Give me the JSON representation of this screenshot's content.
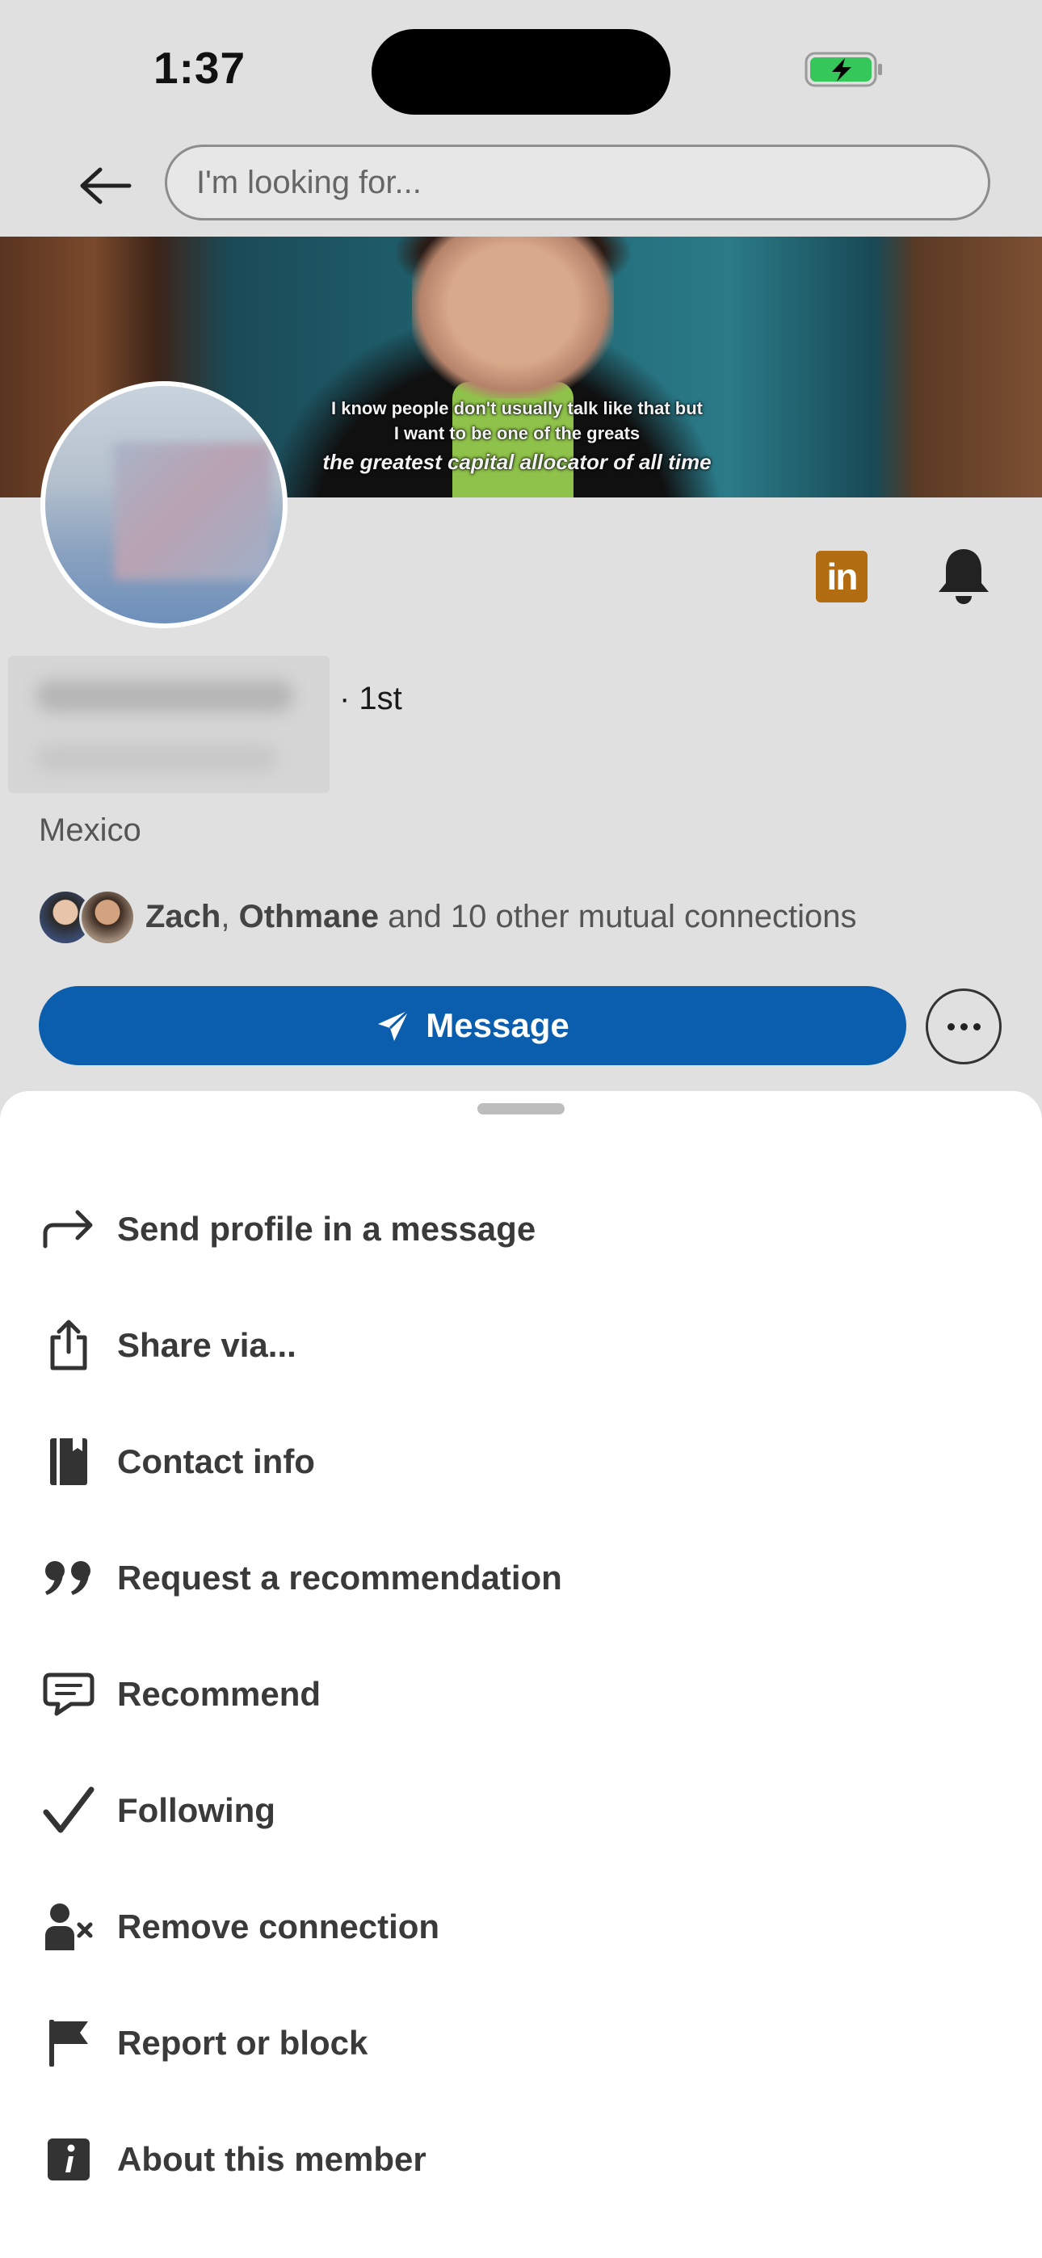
{
  "status_bar": {
    "time": "1:37"
  },
  "header": {
    "search_placeholder": "I'm looking for..."
  },
  "banner": {
    "caption_line1": "I know people don't usually talk like that but",
    "caption_line2": "I want to be one of the greats",
    "caption_line3": "the greatest capital allocator of all time"
  },
  "profile": {
    "linkedin_logo_text": "in",
    "degree": "· 1st",
    "location": "Mexico",
    "mutual": {
      "name1": "Zach",
      "sep": ", ",
      "name2": "Othmane",
      "rest": " and 10 other mutual connections"
    },
    "message_label": "Message"
  },
  "menu": {
    "items": [
      {
        "label": "Send profile in a message",
        "icon": "share-arrow-icon"
      },
      {
        "label": "Share via...",
        "icon": "share-icon"
      },
      {
        "label": "Contact info",
        "icon": "contact-book-icon"
      },
      {
        "label": "Request a recommendation",
        "icon": "quote-icon"
      },
      {
        "label": "Recommend",
        "icon": "chat-bubble-icon"
      },
      {
        "label": "Following",
        "icon": "checkmark-icon"
      },
      {
        "label": "Remove connection",
        "icon": "remove-person-icon"
      },
      {
        "label": "Report or block",
        "icon": "flag-icon"
      },
      {
        "label": "About this member",
        "icon": "info-icon"
      }
    ]
  },
  "colors": {
    "primary": "#0a5ead",
    "linkedin_badge": "#b26c12",
    "battery": "#35c759"
  }
}
